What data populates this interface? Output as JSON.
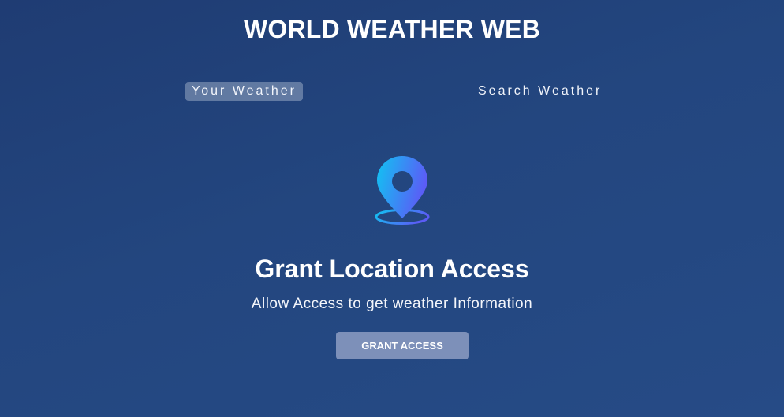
{
  "header": {
    "title": "WORLD WEATHER WEB"
  },
  "tabs": [
    {
      "label": "Your Weather",
      "active": true
    },
    {
      "label": "Search Weather",
      "active": false
    }
  ],
  "grant_access": {
    "icon": "location-pin-icon",
    "title": "Grant Location Access",
    "subtitle": "Allow Access to get weather Information",
    "button_label": "GRANT ACCESS"
  },
  "colors": {
    "background": "#23467f",
    "active_tab": "#5d729b",
    "button": "#7d90b9",
    "icon_gradient_start": "#10c4f2",
    "icon_gradient_end": "#5b5cf6"
  }
}
